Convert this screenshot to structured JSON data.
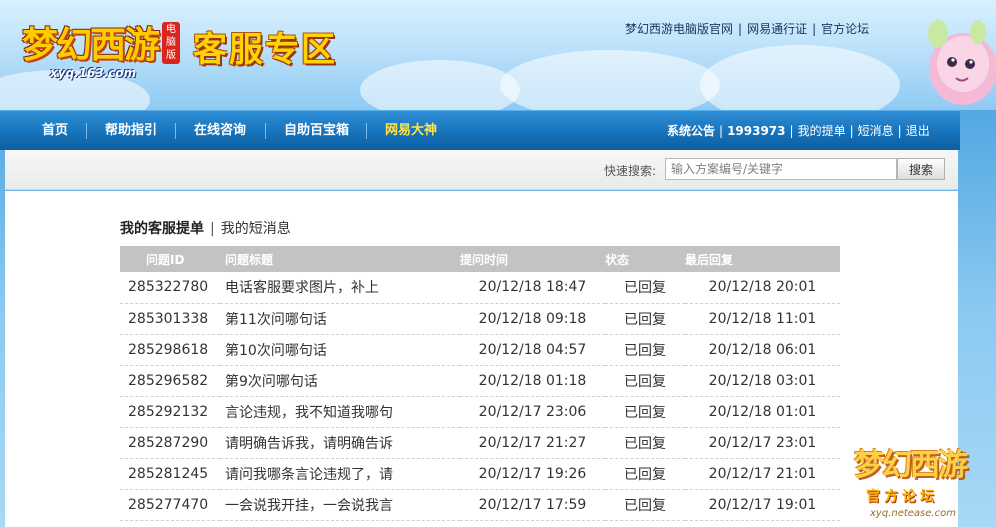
{
  "header": {
    "logo_text": "梦幻西游",
    "logo_badge": "电脑版",
    "logo_url": "xyq.163.com",
    "site_title": "客服专区",
    "top_links": [
      "梦幻西游电脑版官网",
      "网易通行证",
      "官方论坛"
    ]
  },
  "nav": {
    "items": [
      "首页",
      "帮助指引",
      "在线咨询",
      "自助百宝箱",
      "网易大神"
    ],
    "right": {
      "announcement": "系统公告",
      "user_id": "1993973",
      "my_tickets": "我的提单",
      "messages": "短消息",
      "logout": "退出"
    }
  },
  "search": {
    "label": "快速搜索:",
    "placeholder": "输入方案编号/关键字",
    "button": "搜索"
  },
  "tabs": {
    "active": "我的客服提单",
    "other": "我的短消息"
  },
  "table": {
    "headers": [
      "问题ID",
      "问题标题",
      "提问时间",
      "状态",
      "最后回复"
    ],
    "rows": [
      {
        "id": "285322780",
        "title": "电话客服要求图片，补上",
        "time": "20/12/18 18:47",
        "status": "已回复",
        "last": "20/12/18 20:01"
      },
      {
        "id": "285301338",
        "title": "第11次问哪句话",
        "time": "20/12/18 09:18",
        "status": "已回复",
        "last": "20/12/18 11:01"
      },
      {
        "id": "285298618",
        "title": "第10次问哪句话",
        "time": "20/12/18 04:57",
        "status": "已回复",
        "last": "20/12/18 06:01"
      },
      {
        "id": "285296582",
        "title": "第9次问哪句话",
        "time": "20/12/18 01:18",
        "status": "已回复",
        "last": "20/12/18 03:01"
      },
      {
        "id": "285292132",
        "title": "言论违规，我不知道我哪句",
        "time": "20/12/17 23:06",
        "status": "已回复",
        "last": "20/12/18 01:01"
      },
      {
        "id": "285287290",
        "title": "请明确告诉我，请明确告诉",
        "time": "20/12/17 21:27",
        "status": "已回复",
        "last": "20/12/17 23:01"
      },
      {
        "id": "285281245",
        "title": "请问我哪条言论违规了，请",
        "time": "20/12/17 19:26",
        "status": "已回复",
        "last": "20/12/17 21:01"
      },
      {
        "id": "285277470",
        "title": "一会说我开挂，一会说我言",
        "time": "20/12/17 17:59",
        "status": "已回复",
        "last": "20/12/17 19:01"
      }
    ]
  },
  "watermark": {
    "text": "梦幻西游",
    "sub": "官方论坛",
    "url": "xyq.netease.com"
  },
  "colors": {
    "nav_bg": "#1570b8",
    "nav_highlight": "#ffe54a",
    "link": "#1f4a8a",
    "table_header_bg": "#c3c3c3"
  }
}
